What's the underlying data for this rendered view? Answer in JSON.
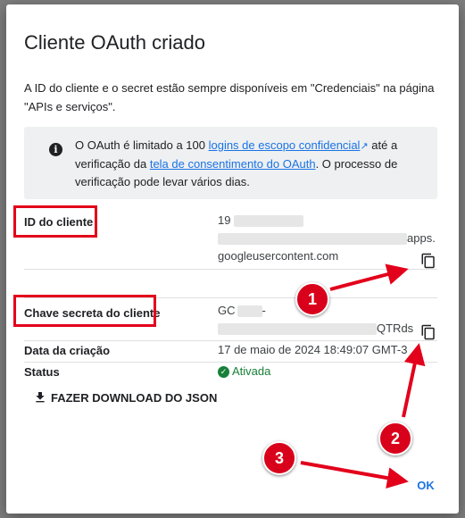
{
  "dialog": {
    "title": "Cliente OAuth criado",
    "intro": "A ID do cliente e o secret estão sempre disponíveis em \"Credenciais\" na página \"APIs e serviços\".",
    "info": {
      "icon": "info-icon",
      "text_1": "O OAuth é limitado a 100 ",
      "link_1": "logins de escopo confidencial",
      "text_2": " até a verificação da ",
      "link_2": "tela de consentimento do OAuth",
      "text_3": ". O processo de verificação pode levar vários dias."
    },
    "client_id": {
      "label": "ID do cliente",
      "value_start": "19",
      "value_mid_end": "apps.",
      "value_line3": "googleusercontent.com"
    },
    "client_secret": {
      "label": "Chave secreta do cliente",
      "value_start": "GC",
      "value_dash": "-",
      "value_end": "QTRds"
    },
    "created": {
      "label": "Data da criação",
      "value": "17 de maio de 2024 18:49:07 GMT-3"
    },
    "status": {
      "label": "Status",
      "value": "Ativada"
    },
    "download_label": "FAZER DOWNLOAD DO JSON",
    "ok_label": "OK"
  },
  "annotations": {
    "badge_1": "1",
    "badge_2": "2",
    "badge_3": "3",
    "color": "#e3001b"
  }
}
